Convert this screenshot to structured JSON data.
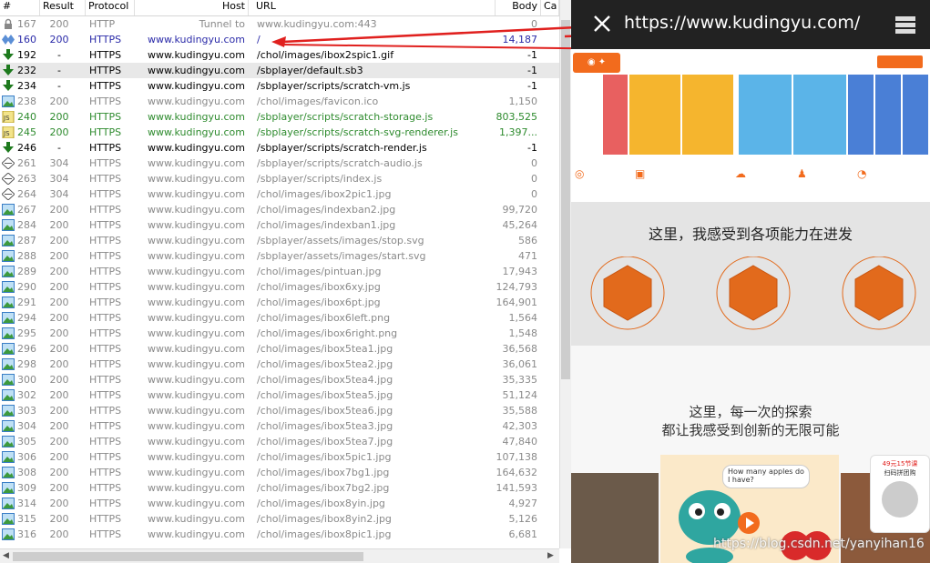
{
  "columns": {
    "num": "#",
    "result": "Result",
    "protocol": "Protocol",
    "host": "Host",
    "url": "URL",
    "body": "Body",
    "caching": "Ca"
  },
  "sessions": [
    {
      "num": "167",
      "result": "200",
      "protocol": "HTTP",
      "host": "Tunnel to",
      "url": "www.kudingyu.com:443",
      "body": "0",
      "icon": "lock-icon",
      "color": "gray"
    },
    {
      "num": "160",
      "result": "200",
      "protocol": "HTTPS",
      "host": "www.kudingyu.com",
      "url": "/",
      "body": "14,187",
      "icon": "diamond-icon",
      "color": "blue"
    },
    {
      "num": "192",
      "result": "-",
      "protocol": "HTTPS",
      "host": "www.kudingyu.com",
      "url": "/chol/images/ibox2spic1.gif",
      "body": "-1",
      "icon": "download-arrow-icon",
      "color": "black"
    },
    {
      "num": "232",
      "result": "-",
      "protocol": "HTTPS",
      "host": "www.kudingyu.com",
      "url": "/sbplayer/default.sb3",
      "body": "-1",
      "icon": "download-arrow-icon",
      "color": "black",
      "selected": true
    },
    {
      "num": "234",
      "result": "-",
      "protocol": "HTTPS",
      "host": "www.kudingyu.com",
      "url": "/sbplayer/scripts/scratch-vm.js",
      "body": "-1",
      "icon": "download-arrow-icon",
      "color": "black"
    },
    {
      "num": "238",
      "result": "200",
      "protocol": "HTTPS",
      "host": "www.kudingyu.com",
      "url": "/chol/images/favicon.ico",
      "body": "1,150",
      "icon": "image-icon",
      "color": "gray"
    },
    {
      "num": "240",
      "result": "200",
      "protocol": "HTTPS",
      "host": "www.kudingyu.com",
      "url": "/sbplayer/scripts/scratch-storage.js",
      "body": "803,525",
      "icon": "js-icon",
      "color": "green"
    },
    {
      "num": "245",
      "result": "200",
      "protocol": "HTTPS",
      "host": "www.kudingyu.com",
      "url": "/sbplayer/scripts/scratch-svg-renderer.js",
      "body": "1,397...",
      "icon": "js-icon",
      "color": "green"
    },
    {
      "num": "246",
      "result": "-",
      "protocol": "HTTPS",
      "host": "www.kudingyu.com",
      "url": "/sbplayer/scripts/scratch-render.js",
      "body": "-1",
      "icon": "download-arrow-icon",
      "color": "black"
    },
    {
      "num": "261",
      "result": "304",
      "protocol": "HTTPS",
      "host": "www.kudingyu.com",
      "url": "/sbplayer/scripts/scratch-audio.js",
      "body": "0",
      "icon": "cached-icon",
      "color": "gray"
    },
    {
      "num": "263",
      "result": "304",
      "protocol": "HTTPS",
      "host": "www.kudingyu.com",
      "url": "/sbplayer/scripts/index.js",
      "body": "0",
      "icon": "cached-icon",
      "color": "gray"
    },
    {
      "num": "264",
      "result": "304",
      "protocol": "HTTPS",
      "host": "www.kudingyu.com",
      "url": "/chol/images/ibox2pic1.jpg",
      "body": "0",
      "icon": "cached-icon",
      "color": "gray"
    },
    {
      "num": "267",
      "result": "200",
      "protocol": "HTTPS",
      "host": "www.kudingyu.com",
      "url": "/chol/images/indexban2.jpg",
      "body": "99,720",
      "icon": "image-icon",
      "color": "gray"
    },
    {
      "num": "284",
      "result": "200",
      "protocol": "HTTPS",
      "host": "www.kudingyu.com",
      "url": "/chol/images/indexban1.jpg",
      "body": "45,264",
      "icon": "image-icon",
      "color": "gray"
    },
    {
      "num": "287",
      "result": "200",
      "protocol": "HTTPS",
      "host": "www.kudingyu.com",
      "url": "/sbplayer/assets/images/stop.svg",
      "body": "586",
      "icon": "image-icon",
      "color": "gray"
    },
    {
      "num": "288",
      "result": "200",
      "protocol": "HTTPS",
      "host": "www.kudingyu.com",
      "url": "/sbplayer/assets/images/start.svg",
      "body": "471",
      "icon": "image-icon",
      "color": "gray"
    },
    {
      "num": "289",
      "result": "200",
      "protocol": "HTTPS",
      "host": "www.kudingyu.com",
      "url": "/chol/images/pintuan.jpg",
      "body": "17,943",
      "icon": "image-icon",
      "color": "gray"
    },
    {
      "num": "290",
      "result": "200",
      "protocol": "HTTPS",
      "host": "www.kudingyu.com",
      "url": "/chol/images/ibox6xy.jpg",
      "body": "124,793",
      "icon": "image-icon",
      "color": "gray"
    },
    {
      "num": "291",
      "result": "200",
      "protocol": "HTTPS",
      "host": "www.kudingyu.com",
      "url": "/chol/images/ibox6pt.jpg",
      "body": "164,901",
      "icon": "image-icon",
      "color": "gray"
    },
    {
      "num": "294",
      "result": "200",
      "protocol": "HTTPS",
      "host": "www.kudingyu.com",
      "url": "/chol/images/ibox6left.png",
      "body": "1,564",
      "icon": "image-icon",
      "color": "gray"
    },
    {
      "num": "295",
      "result": "200",
      "protocol": "HTTPS",
      "host": "www.kudingyu.com",
      "url": "/chol/images/ibox6right.png",
      "body": "1,548",
      "icon": "image-icon",
      "color": "gray"
    },
    {
      "num": "296",
      "result": "200",
      "protocol": "HTTPS",
      "host": "www.kudingyu.com",
      "url": "/chol/images/ibox5tea1.jpg",
      "body": "36,568",
      "icon": "image-icon",
      "color": "gray"
    },
    {
      "num": "298",
      "result": "200",
      "protocol": "HTTPS",
      "host": "www.kudingyu.com",
      "url": "/chol/images/ibox5tea2.jpg",
      "body": "36,061",
      "icon": "image-icon",
      "color": "gray"
    },
    {
      "num": "300",
      "result": "200",
      "protocol": "HTTPS",
      "host": "www.kudingyu.com",
      "url": "/chol/images/ibox5tea4.jpg",
      "body": "35,335",
      "icon": "image-icon",
      "color": "gray"
    },
    {
      "num": "302",
      "result": "200",
      "protocol": "HTTPS",
      "host": "www.kudingyu.com",
      "url": "/chol/images/ibox5tea5.jpg",
      "body": "51,124",
      "icon": "image-icon",
      "color": "gray"
    },
    {
      "num": "303",
      "result": "200",
      "protocol": "HTTPS",
      "host": "www.kudingyu.com",
      "url": "/chol/images/ibox5tea6.jpg",
      "body": "35,588",
      "icon": "image-icon",
      "color": "gray"
    },
    {
      "num": "304",
      "result": "200",
      "protocol": "HTTPS",
      "host": "www.kudingyu.com",
      "url": "/chol/images/ibox5tea3.jpg",
      "body": "42,303",
      "icon": "image-icon",
      "color": "gray"
    },
    {
      "num": "305",
      "result": "200",
      "protocol": "HTTPS",
      "host": "www.kudingyu.com",
      "url": "/chol/images/ibox5tea7.jpg",
      "body": "47,840",
      "icon": "image-icon",
      "color": "gray"
    },
    {
      "num": "306",
      "result": "200",
      "protocol": "HTTPS",
      "host": "www.kudingyu.com",
      "url": "/chol/images/ibox5pic1.jpg",
      "body": "107,138",
      "icon": "image-icon",
      "color": "gray"
    },
    {
      "num": "308",
      "result": "200",
      "protocol": "HTTPS",
      "host": "www.kudingyu.com",
      "url": "/chol/images/ibox7bg1.jpg",
      "body": "164,632",
      "icon": "image-icon",
      "color": "gray"
    },
    {
      "num": "309",
      "result": "200",
      "protocol": "HTTPS",
      "host": "www.kudingyu.com",
      "url": "/chol/images/ibox7bg2.jpg",
      "body": "141,593",
      "icon": "image-icon",
      "color": "gray"
    },
    {
      "num": "314",
      "result": "200",
      "protocol": "HTTPS",
      "host": "www.kudingyu.com",
      "url": "/chol/images/ibox8yin.jpg",
      "body": "4,927",
      "icon": "image-icon",
      "color": "gray"
    },
    {
      "num": "315",
      "result": "200",
      "protocol": "HTTPS",
      "host": "www.kudingyu.com",
      "url": "/chol/images/ibox8yin2.jpg",
      "body": "5,126",
      "icon": "image-icon",
      "color": "gray"
    },
    {
      "num": "316",
      "result": "200",
      "protocol": "HTTPS",
      "host": "www.kudingyu.com",
      "url": "/chol/images/ibox8pic1.jpg",
      "body": "6,681",
      "icon": "image-icon",
      "color": "gray"
    }
  ],
  "colors": {
    "gray": "#8a8a8a",
    "black": "#000000",
    "blue": "#2a2aa8",
    "green": "#2e8b2e",
    "arrow": "#e0201e",
    "accent": "#f26b1d"
  },
  "browser": {
    "url": "https://www.kudingyu.com/"
  },
  "site": {
    "hero1_title": "这里，我感受到各项能力在进发",
    "hero2_line1": "这里，每一次的探索",
    "hero2_line2": "都让我感受到创新的无限可能",
    "bubble_text": "How many apples do I have?",
    "promo_text": "49元15节课",
    "promo_sub": "扫码拼团购",
    "watermark": "https://blog.csdn.net/yanyihan16"
  }
}
